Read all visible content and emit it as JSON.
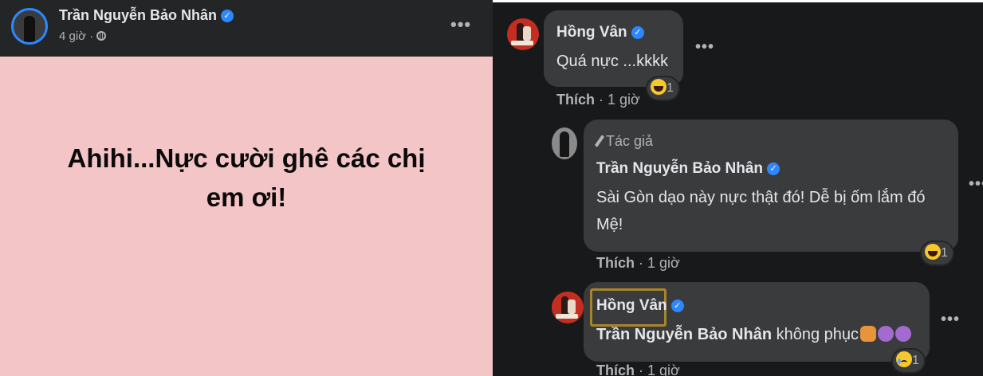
{
  "post": {
    "author": "Trần Nguyễn Bảo Nhân",
    "time": "4 giờ ·",
    "more_label": "•••",
    "text_line1": "Ahihi...Nực cười ghê các chị",
    "text_line2": "em ơi!",
    "background_color": "#f4c5c6"
  },
  "comments": [
    {
      "author": "Hồng Vân",
      "text": "Quá nực ...kkkk",
      "action_like": "Thích",
      "time": "· 1 giờ",
      "reaction_count": "1",
      "reaction": "haha-icon",
      "more_label": "•••"
    },
    {
      "author_tag": "Tác giả",
      "author": "Trần Nguyễn Bảo Nhân",
      "text_line1": "Sài Gòn dạo này nực thật đó! Dễ bị ốm lắm đó",
      "text_line2": "Mệ!",
      "action_like": "Thích",
      "time": "· 1 giờ",
      "reaction_count": "1",
      "reaction": "haha-icon",
      "more_label": "•••"
    },
    {
      "author": "Hồng Vân",
      "mention": "Trần Nguyễn Bảo Nhân",
      "text": "không phục",
      "action_like": "Thích",
      "time": "· 1 giờ",
      "reaction_count": "1",
      "reaction": "sad-icon",
      "more_label": "•••"
    }
  ],
  "colors": {
    "accent": "#2d88ff",
    "panel_dark": "#242526",
    "bubble": "#3a3b3c",
    "highlight_box": "#a8842a"
  }
}
